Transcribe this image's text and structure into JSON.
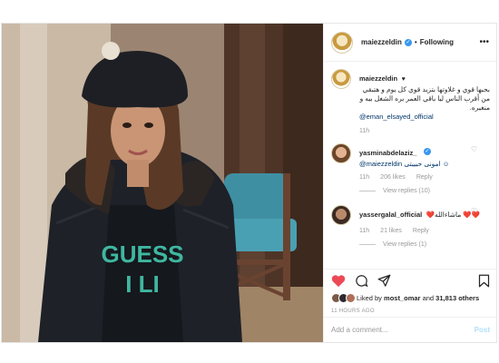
{
  "header": {
    "username": "maiezzeldin",
    "verified_glyph": "✓",
    "separator": "•",
    "follow_status": "Following",
    "more_glyph": "•••"
  },
  "caption": {
    "username": "maiezzeldin",
    "text": "بحبها قوي و غلاوتها بتزيد قوي كل يوم و هتبقي من أقرب الناس ليا باقي العمر بره الشغل بيه و منغيره.",
    "mention": "@eman_elsayed_official",
    "time": "11h"
  },
  "comments": [
    {
      "username": "yasminabdelaziz_",
      "text": "@maiezzeldin امونى حبيبتى ☺",
      "time": "11h",
      "likes": "206 likes",
      "reply_label": "Reply",
      "view_replies": "View replies (10)"
    },
    {
      "username": "yassergalal_official",
      "text": "❤️ماشاءالله ❤️❤️",
      "time": "11h",
      "likes": "21 likes",
      "reply_label": "Reply",
      "view_replies": "View replies (1)"
    }
  ],
  "likes_line": {
    "prefix": "Liked by",
    "user": "most_omar",
    "middle": "and",
    "others": "31,813 others"
  },
  "time_ago": "11 HOURS AGO",
  "add_comment": {
    "placeholder": "Add a comment...",
    "post_label": "Post"
  },
  "photo": {
    "shirt_text_line1": "GUESS",
    "shirt_text_line2": "I LI",
    "description_icon": "post-photo"
  },
  "colors": {
    "like_red": "#ed4956",
    "link_blue": "#003569",
    "verified_blue": "#3897f0",
    "muted_gray": "#999999"
  }
}
